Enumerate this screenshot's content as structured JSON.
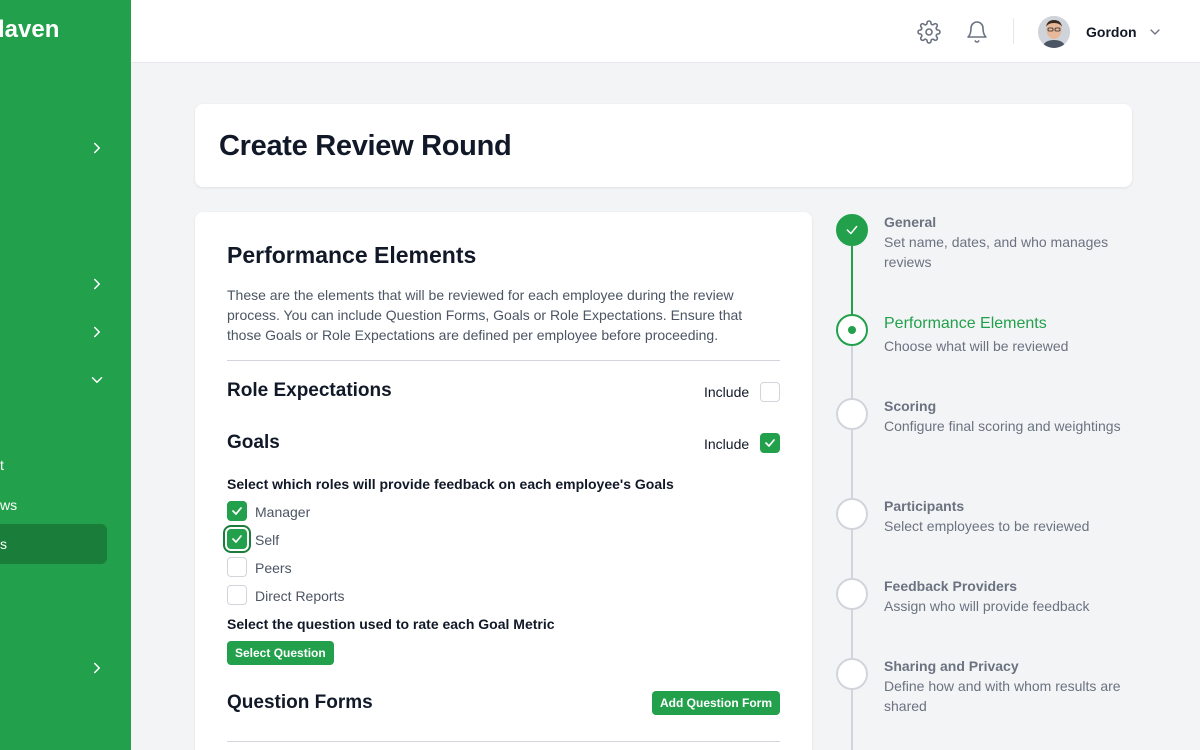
{
  "sidebar": {
    "brand": "laven",
    "items": [
      {
        "text": ""
      },
      {
        "text": ""
      },
      {
        "text": ""
      },
      {
        "text": ""
      },
      {
        "text": "t"
      },
      {
        "text": "ws"
      },
      {
        "text": "s"
      },
      {
        "text": ""
      }
    ]
  },
  "topbar": {
    "username": "Gordon"
  },
  "page": {
    "title": "Create Review Round"
  },
  "main": {
    "title": "Performance Elements",
    "description": "These are the elements that will be reviewed for each employee during the review process. You can include Question Forms, Goals or Role Expectations. Ensure that those Goals or Role Expectations are defined per employee before proceeding.",
    "role_expectations": {
      "title": "Role Expectations",
      "include_label": "Include",
      "checked": false
    },
    "goals": {
      "title": "Goals",
      "include_label": "Include",
      "checked": true,
      "feedback_prompt": "Select which roles will provide feedback on each employee's Goals",
      "roles": [
        {
          "label": "Manager",
          "checked": true
        },
        {
          "label": "Self",
          "checked": true
        },
        {
          "label": "Peers",
          "checked": false
        },
        {
          "label": "Direct Reports",
          "checked": false
        }
      ],
      "question_prompt": "Select the question used to rate each Goal Metric",
      "select_question_label": "Select Question"
    },
    "question_forms": {
      "title": "Question Forms",
      "add_label": "Add Question Form"
    }
  },
  "stepper": {
    "steps": [
      {
        "title": "General",
        "desc": "Set name, dates, and who manages reviews",
        "state": "done"
      },
      {
        "title": "Performance Elements",
        "desc": "Choose what will be reviewed",
        "state": "current"
      },
      {
        "title": "Scoring",
        "desc": "Configure final scoring and weightings",
        "state": "upcoming"
      },
      {
        "title": "Participants",
        "desc": "Select employees to be reviewed",
        "state": "upcoming"
      },
      {
        "title": "Feedback Providers",
        "desc": "Assign who will provide feedback",
        "state": "upcoming"
      },
      {
        "title": "Sharing and Privacy",
        "desc": "Define how and with whom results are shared",
        "state": "upcoming"
      }
    ]
  },
  "colors": {
    "accent": "#22a04b",
    "accent_dark": "#1a7d3a"
  }
}
